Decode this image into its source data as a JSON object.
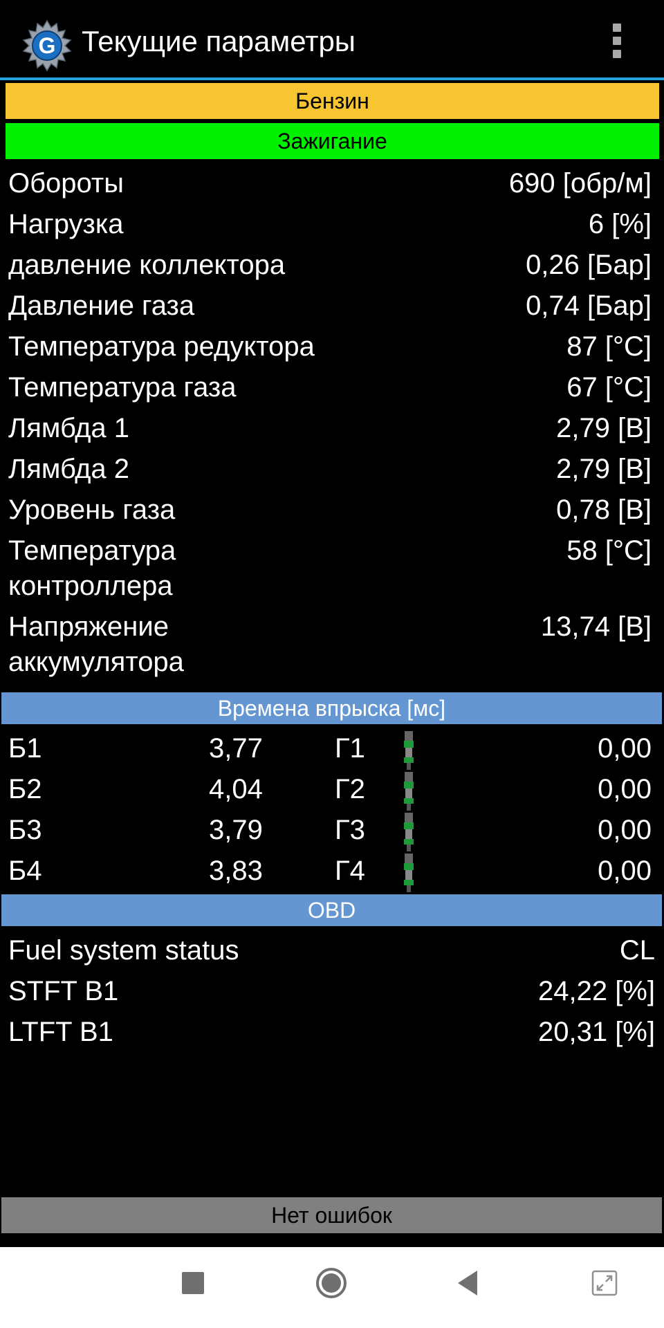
{
  "header": {
    "title": "Текущие параметры",
    "logo_letter": "G",
    "logo_icon": "gear-logo-icon",
    "menu_icon": "overflow-menu-icon"
  },
  "status": {
    "fuel": "Бензин",
    "fuel_color": "#f7c531",
    "ignition": "Зажигание",
    "ignition_color": "#00f000"
  },
  "params": [
    {
      "label": "Обороты",
      "value": "690 [обр/м]"
    },
    {
      "label": "Нагрузка",
      "value": "6 [%]"
    },
    {
      "label": "давление коллектора",
      "value": "0,26 [Бар]"
    },
    {
      "label": "Давление газа",
      "value": "0,74 [Бар]"
    },
    {
      "label": "Температура редуктора",
      "value": "87 [°C]"
    },
    {
      "label": "Температура газа",
      "value": "67 [°C]"
    },
    {
      "label": "Лямбда 1",
      "value": "2,79 [В]"
    },
    {
      "label": "Лямбда 2",
      "value": "2,79 [В]"
    },
    {
      "label": "Уровень газа",
      "value": "0,78 [В]"
    },
    {
      "label": "Температура контроллера",
      "value": "58 [°C]"
    },
    {
      "label": "Напряжение аккумулятора",
      "value": "13,74 [В]"
    }
  ],
  "injection": {
    "title": "Времена впрыска [мс]",
    "rows": [
      {
        "b_label": "Б1",
        "b_value": "3,77",
        "g_label": "Г1",
        "g_value": "0,00"
      },
      {
        "b_label": "Б2",
        "b_value": "4,04",
        "g_label": "Г2",
        "g_value": "0,00"
      },
      {
        "b_label": "Б3",
        "b_value": "3,79",
        "g_label": "Г3",
        "g_value": "0,00"
      },
      {
        "b_label": "Б4",
        "b_value": "3,83",
        "g_label": "Г4",
        "g_value": "0,00"
      }
    ]
  },
  "obd": {
    "title": "OBD",
    "rows": [
      {
        "label": "Fuel system status",
        "value": "CL"
      },
      {
        "label": "STFT B1",
        "value": "24,22 [%]"
      },
      {
        "label": "LTFT B1",
        "value": "20,31 [%]"
      }
    ]
  },
  "errors": {
    "text": "Нет ошибок"
  },
  "section_color": "#6497d2",
  "nav": {
    "icons": [
      "recents-square-icon",
      "home-circle-icon",
      "back-triangle-icon",
      "expand-icon"
    ]
  }
}
